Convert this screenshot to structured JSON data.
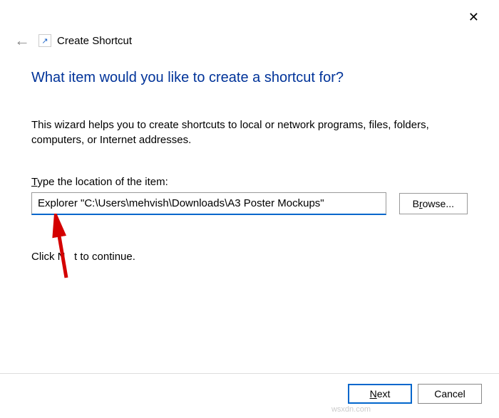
{
  "window": {
    "title": "Create Shortcut"
  },
  "content": {
    "heading": "What item would you like to create a shortcut for?",
    "description": "This wizard helps you to create shortcuts to local or network programs, files, folders, computers, or Internet addresses.",
    "field_label_pre": "T",
    "field_label_rest": "ype the location of the item:",
    "location_value": "Explorer \"C:\\Users\\mehvish\\Downloads\\A3 Poster Mockups\"",
    "browse_label": "Browse...",
    "continue_text_pre": "Click N",
    "continue_text_post": "t to continue."
  },
  "footer": {
    "next": "Next",
    "cancel": "Cancel"
  },
  "watermark": "wsxdn.com"
}
